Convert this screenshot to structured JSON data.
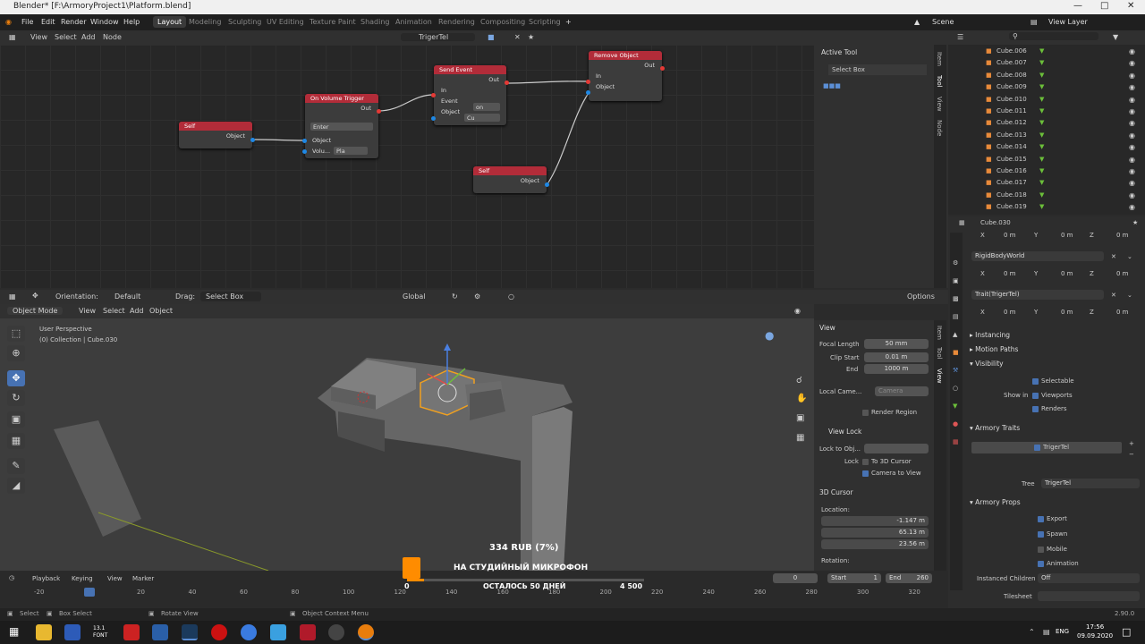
{
  "window": {
    "title": "Blender* [F:\\ArmoryProject1\\Platform.blend]"
  },
  "menu": [
    "File",
    "Edit",
    "Render",
    "Window",
    "Help"
  ],
  "workspaces": [
    "Layout",
    "Modeling",
    "Sculpting",
    "UV Editing",
    "Texture Paint",
    "Shading",
    "Animation",
    "Rendering",
    "Compositing",
    "Scripting"
  ],
  "scene": "Scene",
  "view_layer": "View Layer",
  "node_header": {
    "items": [
      "View",
      "Select",
      "Add",
      "Node"
    ],
    "tree_name": "TrigerTel"
  },
  "nodes": {
    "self1": {
      "title": "Self",
      "out": "Object"
    },
    "volume": {
      "title": "On Volume Trigger",
      "out": "Out",
      "event": "Enter",
      "in_object": "Object",
      "volu": "Volu...",
      "volu_val": "Pla"
    },
    "send": {
      "title": "Send Event",
      "out": "Out",
      "in": "In",
      "event_label": "Event",
      "event_val": "on",
      "object": "Object",
      "object_val": "Cu"
    },
    "remove": {
      "title": "Remove Object",
      "out": "Out",
      "in": "In",
      "object": "Object"
    },
    "self2": {
      "title": "Self",
      "out": "Object"
    }
  },
  "active_tool": {
    "title": "Active Tool",
    "tool": "Select Box"
  },
  "node_tabs": [
    "Item",
    "Tool",
    "View",
    "Node"
  ],
  "toolbar3d": {
    "orientation_label": "Orientation:",
    "orientation": "Default",
    "drag_label": "Drag:",
    "drag": "Select Box",
    "transform": "Global",
    "options": "Options"
  },
  "viewport_header": {
    "mode": "Object Mode",
    "items": [
      "View",
      "Select",
      "Add",
      "Object"
    ]
  },
  "viewport_info": {
    "line1": "User Perspective",
    "line2": "(0) Collection | Cube.030"
  },
  "viewport_tabs": [
    "Item",
    "Tool",
    "View"
  ],
  "view_panel": {
    "title": "View",
    "focal_label": "Focal Length",
    "focal": "50 mm",
    "clip_start_label": "Clip Start",
    "clip_start": "0.01 m",
    "end_label": "End",
    "end": "1000 m",
    "local_camera": "Local Came...",
    "camera": "Camera",
    "render_region": "Render Region",
    "view_lock": "View Lock",
    "lock_to_obj": "Lock to Obj...",
    "lock": "Lock",
    "to_3d_cursor": "To 3D Cursor",
    "camera_to_view": "Camera to View"
  },
  "cursor_panel": {
    "title": "3D Cursor",
    "location": "Location:",
    "x_label": "X",
    "x": "-1.147 m",
    "y_label": "Y",
    "y": "65.13 m",
    "z_label": "Z",
    "z": "23.56 m",
    "rotation": "Rotation:"
  },
  "outliner": [
    "Cube.006",
    "Cube.007",
    "Cube.008",
    "Cube.009",
    "Cube.010",
    "Cube.011",
    "Cube.012",
    "Cube.013",
    "Cube.014",
    "Cube.015",
    "Cube.016",
    "Cube.017",
    "Cube.018",
    "Cube.019"
  ],
  "properties": {
    "object": "Cube.030",
    "xyz": {
      "x": "X",
      "y": "Y",
      "z": "Z",
      "val": "0 m"
    },
    "trait1": "RigidBodyWorld",
    "trait2": "Trait(TrigerTel)",
    "sections": {
      "instancing": "Instancing",
      "motion": "Motion Paths",
      "visibility": "Visibility",
      "traits": "Armory Traits",
      "props": "Armory Props"
    },
    "selectable": "Selectable",
    "show_in": "Show in",
    "viewports": "Viewports",
    "renders": "Renders",
    "trait_item": "TrigerTel",
    "tree_label": "Tree",
    "tree_val": "TrigerTel",
    "export": "Export",
    "spawn": "Spawn",
    "mobile": "Mobile",
    "animation": "Animation",
    "instanced_children": "Instanced Children",
    "inst_val": "Off",
    "tilesheet": "Tilesheet"
  },
  "timeline": {
    "items": [
      "Playback",
      "Keying",
      "View",
      "Marker"
    ],
    "frame": "0",
    "start_label": "Start",
    "start": "1",
    "end_label": "End",
    "end": "260",
    "ticks": [
      "-20",
      "0",
      "20",
      "40",
      "60",
      "80",
      "100",
      "120",
      "140",
      "160",
      "180",
      "200",
      "220",
      "240",
      "260",
      "280",
      "300",
      "320"
    ]
  },
  "status": {
    "select": "Select",
    "box": "Box Select",
    "rotate": "Rotate View",
    "context": "Object Context Menu",
    "version": "2.90.0"
  },
  "donation": {
    "amount": "334 RUB (7%)",
    "goal": "НА СТУДИЙНЫЙ МИКРОФОН",
    "left": "ОСТАЛОСЬ 50 ДНЕЙ",
    "zero": "0",
    "max": "4 500",
    "progress": 0.07
  },
  "taskbar": {
    "lang": "ENG",
    "time": "17:56",
    "date": "09.09.2020",
    "font_label": "13.1 FONT"
  }
}
